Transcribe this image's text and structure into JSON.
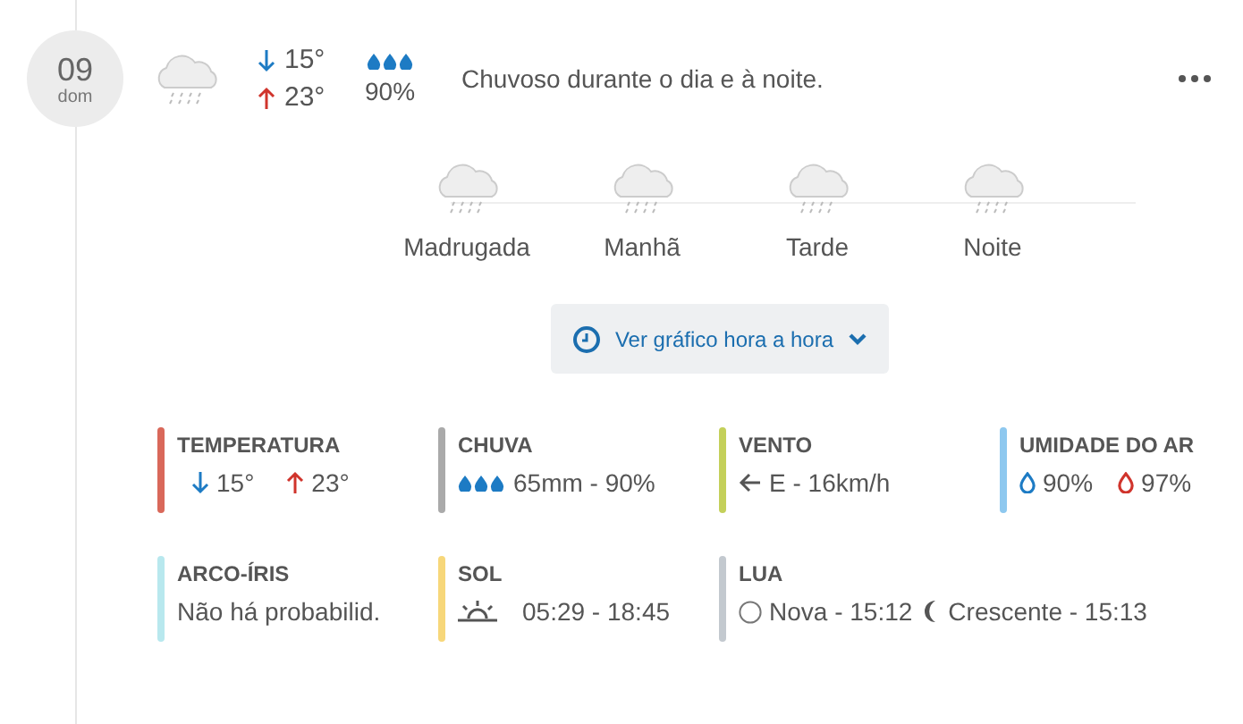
{
  "day": {
    "number": "09",
    "weekday": "dom"
  },
  "summary": {
    "low": "15°",
    "high": "23°",
    "rain_chance": "90%",
    "description": "Chuvoso durante o dia e à noite."
  },
  "periods": [
    {
      "label": "Madrugada"
    },
    {
      "label": "Manhã"
    },
    {
      "label": "Tarde"
    },
    {
      "label": "Noite"
    }
  ],
  "hourly_button": {
    "label": "Ver gráfico hora a hora"
  },
  "details": [
    {
      "kind": "temperature",
      "label": "TEMPERATURA",
      "color": "#d9685a",
      "low": "15°",
      "high": "23°"
    },
    {
      "kind": "rain",
      "label": "CHUVA",
      "color": "#aaaaaa",
      "text": "65mm - 90%"
    },
    {
      "kind": "wind",
      "label": "VENTO",
      "color": "#c4d05a",
      "text": "E - 16km/h"
    },
    {
      "kind": "humidity",
      "label": "UMIDADE DO AR",
      "color": "#8ec8ef",
      "low": "90%",
      "high": "97%"
    },
    {
      "kind": "text",
      "label": "ARCO-ÍRIS",
      "color": "#b8e8ee",
      "text": "Não há probabilid."
    },
    {
      "kind": "sun",
      "label": "SOL",
      "color": "#f7d77a",
      "text": "05:29 - 18:45"
    },
    {
      "kind": "moon",
      "label": "LUA",
      "color": "#c3c9cf",
      "phases": [
        {
          "kind": "new",
          "text": "Nova - 15:12"
        },
        {
          "kind": "crescent",
          "text": "Crescente - 15:13"
        }
      ]
    }
  ]
}
